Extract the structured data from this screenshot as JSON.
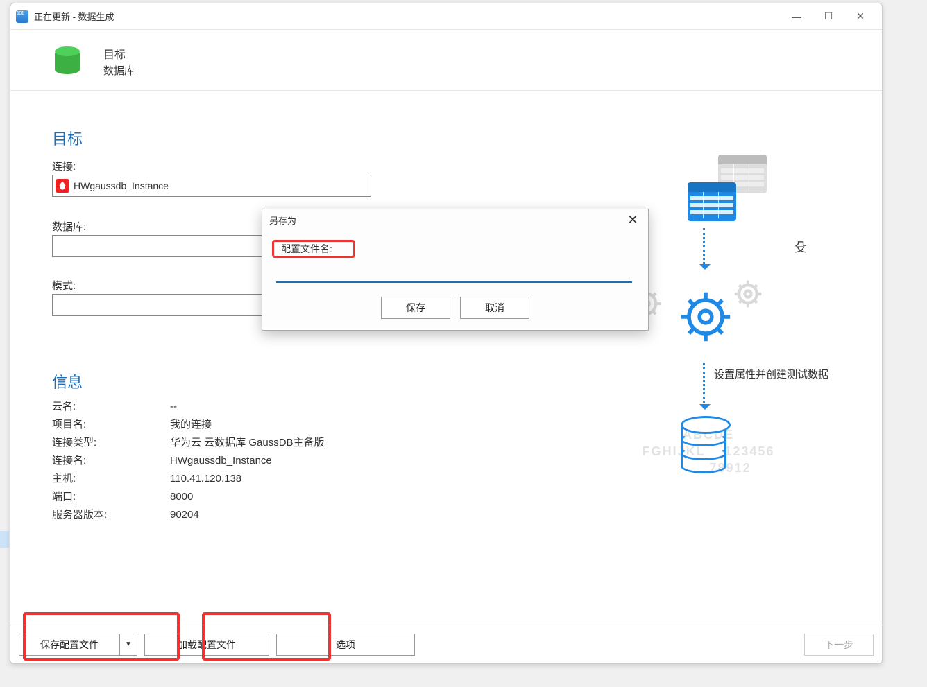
{
  "window": {
    "title": "正在更新 - 数据生成"
  },
  "header": {
    "line1": "目标",
    "line2": "数据库"
  },
  "target": {
    "section_title": "目标",
    "connection_label": "连接:",
    "connection_value": "HWgaussdb_Instance",
    "database_label": "数据库:",
    "database_value": "",
    "schema_label": "模式:",
    "schema_value": ""
  },
  "info": {
    "section_title": "信息",
    "rows": [
      {
        "k": "云名:",
        "v": "--"
      },
      {
        "k": "项目名:",
        "v": "我的连接"
      },
      {
        "k": "连接类型:",
        "v": "华为云 云数据库 GaussDB主备版"
      },
      {
        "k": "连接名:",
        "v": "HWgaussdb_Instance"
      },
      {
        "k": "主机:",
        "v": "110.41.120.138"
      },
      {
        "k": "端口:",
        "v": "8000"
      },
      {
        "k": "服务器版本:",
        "v": "90204"
      }
    ]
  },
  "illus": {
    "k_char": "殳",
    "caption": "设置属性并创建测试数据",
    "ghost1": "ABCDE",
    "ghost2": "FGHIJKL    123456",
    "ghost3": "         78912"
  },
  "footer": {
    "save_profile": "保存配置文件",
    "load_profile": "加载配置文件",
    "options": "选项",
    "next": "下一步"
  },
  "modal": {
    "title": "另存为",
    "label": "配置文件名:",
    "input_value": "",
    "save": "保存",
    "cancel": "取消"
  }
}
